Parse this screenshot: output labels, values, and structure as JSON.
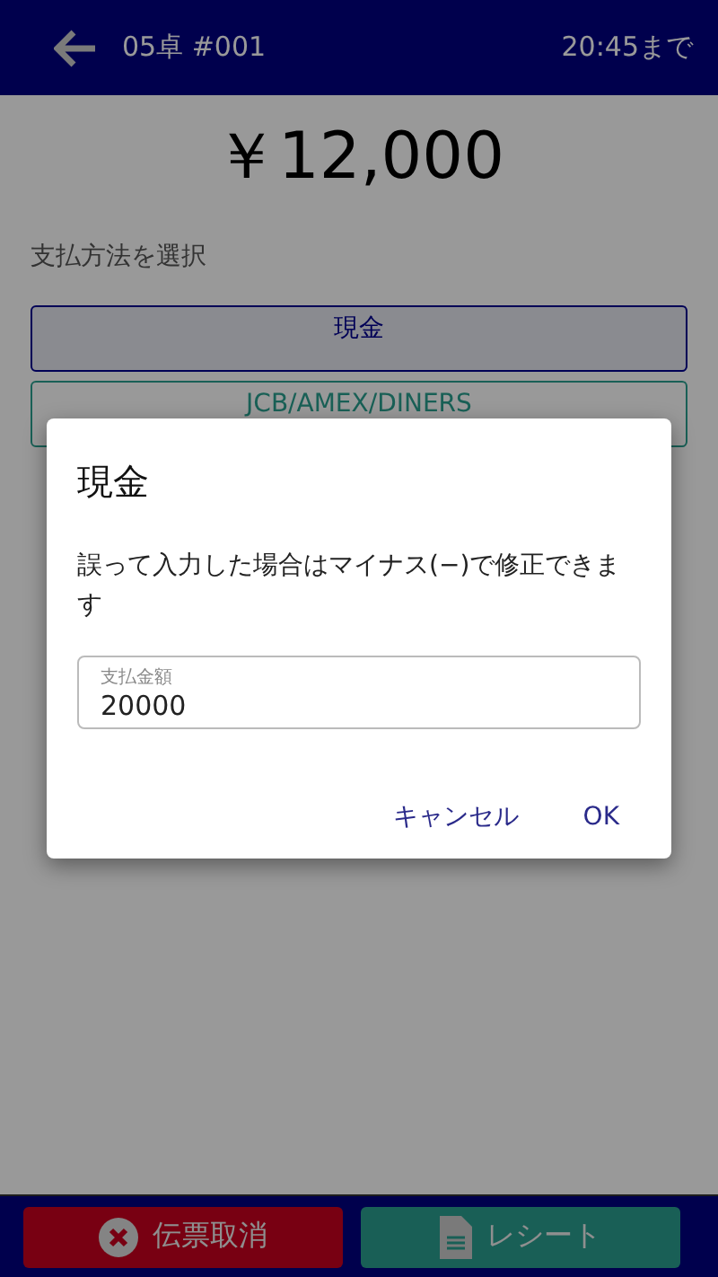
{
  "header": {
    "title": "05卓 #001",
    "deadline": "20:45まで"
  },
  "total": "￥12,000",
  "section_label": "支払方法を選択",
  "payment_methods": [
    {
      "label": "現金",
      "selected": true
    },
    {
      "label": "JCB/AMEX/DINERS",
      "selected": false
    }
  ],
  "dialog": {
    "title": "現金",
    "message": "誤って入力した場合はマイナス(−)で修正できます",
    "field": {
      "label": "支払金額",
      "value": "20000"
    },
    "actions": [
      "キャンセル",
      "OK"
    ]
  },
  "footer": [
    {
      "kind": "cancel",
      "label": "伝票取消"
    },
    {
      "kind": "receipt",
      "label": "レシート"
    }
  ]
}
